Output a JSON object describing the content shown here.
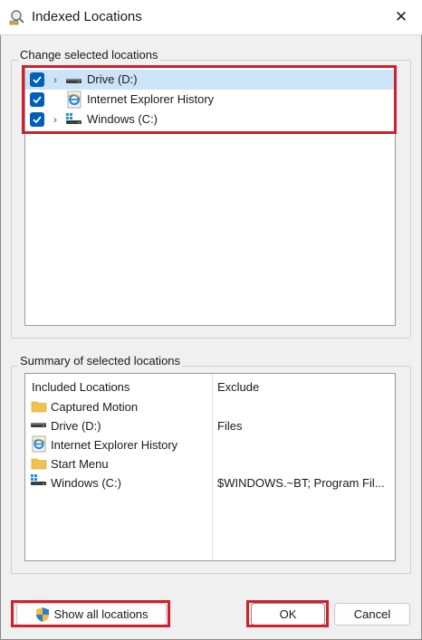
{
  "window": {
    "title": "Indexed Locations",
    "close_glyph": "✕"
  },
  "change_group": {
    "label": "Change selected locations",
    "items": [
      {
        "label": "Drive (D:)",
        "checked": true,
        "expandable": true,
        "icon": "drive-icon",
        "selected": true
      },
      {
        "label": "Internet Explorer History",
        "checked": true,
        "expandable": false,
        "icon": "internet-explorer-icon",
        "selected": false
      },
      {
        "label": "Windows (C:)",
        "checked": true,
        "expandable": true,
        "icon": "windows-drive-icon",
        "selected": false
      }
    ]
  },
  "summary_group": {
    "label": "Summary of selected locations",
    "columns": [
      "Included Locations",
      "Exclude"
    ],
    "rows": [
      {
        "location": "Captured Motion",
        "exclude": "",
        "icon": "folder-icon"
      },
      {
        "location": "Drive (D:)",
        "exclude": "Files",
        "icon": "drive-icon"
      },
      {
        "location": "Internet Explorer History",
        "exclude": "",
        "icon": "internet-explorer-icon"
      },
      {
        "location": "Start Menu",
        "exclude": "",
        "icon": "folder-icon"
      },
      {
        "location": "Windows (C:)",
        "exclude": "$WINDOWS.~BT; Program Fil...",
        "icon": "windows-drive-icon"
      }
    ]
  },
  "buttons": {
    "show_all": "Show all locations",
    "ok": "OK",
    "cancel": "Cancel"
  },
  "colors": {
    "highlight": "#d01f2e",
    "checkbox": "#005fb8",
    "selected_row": "#cce4f7"
  }
}
